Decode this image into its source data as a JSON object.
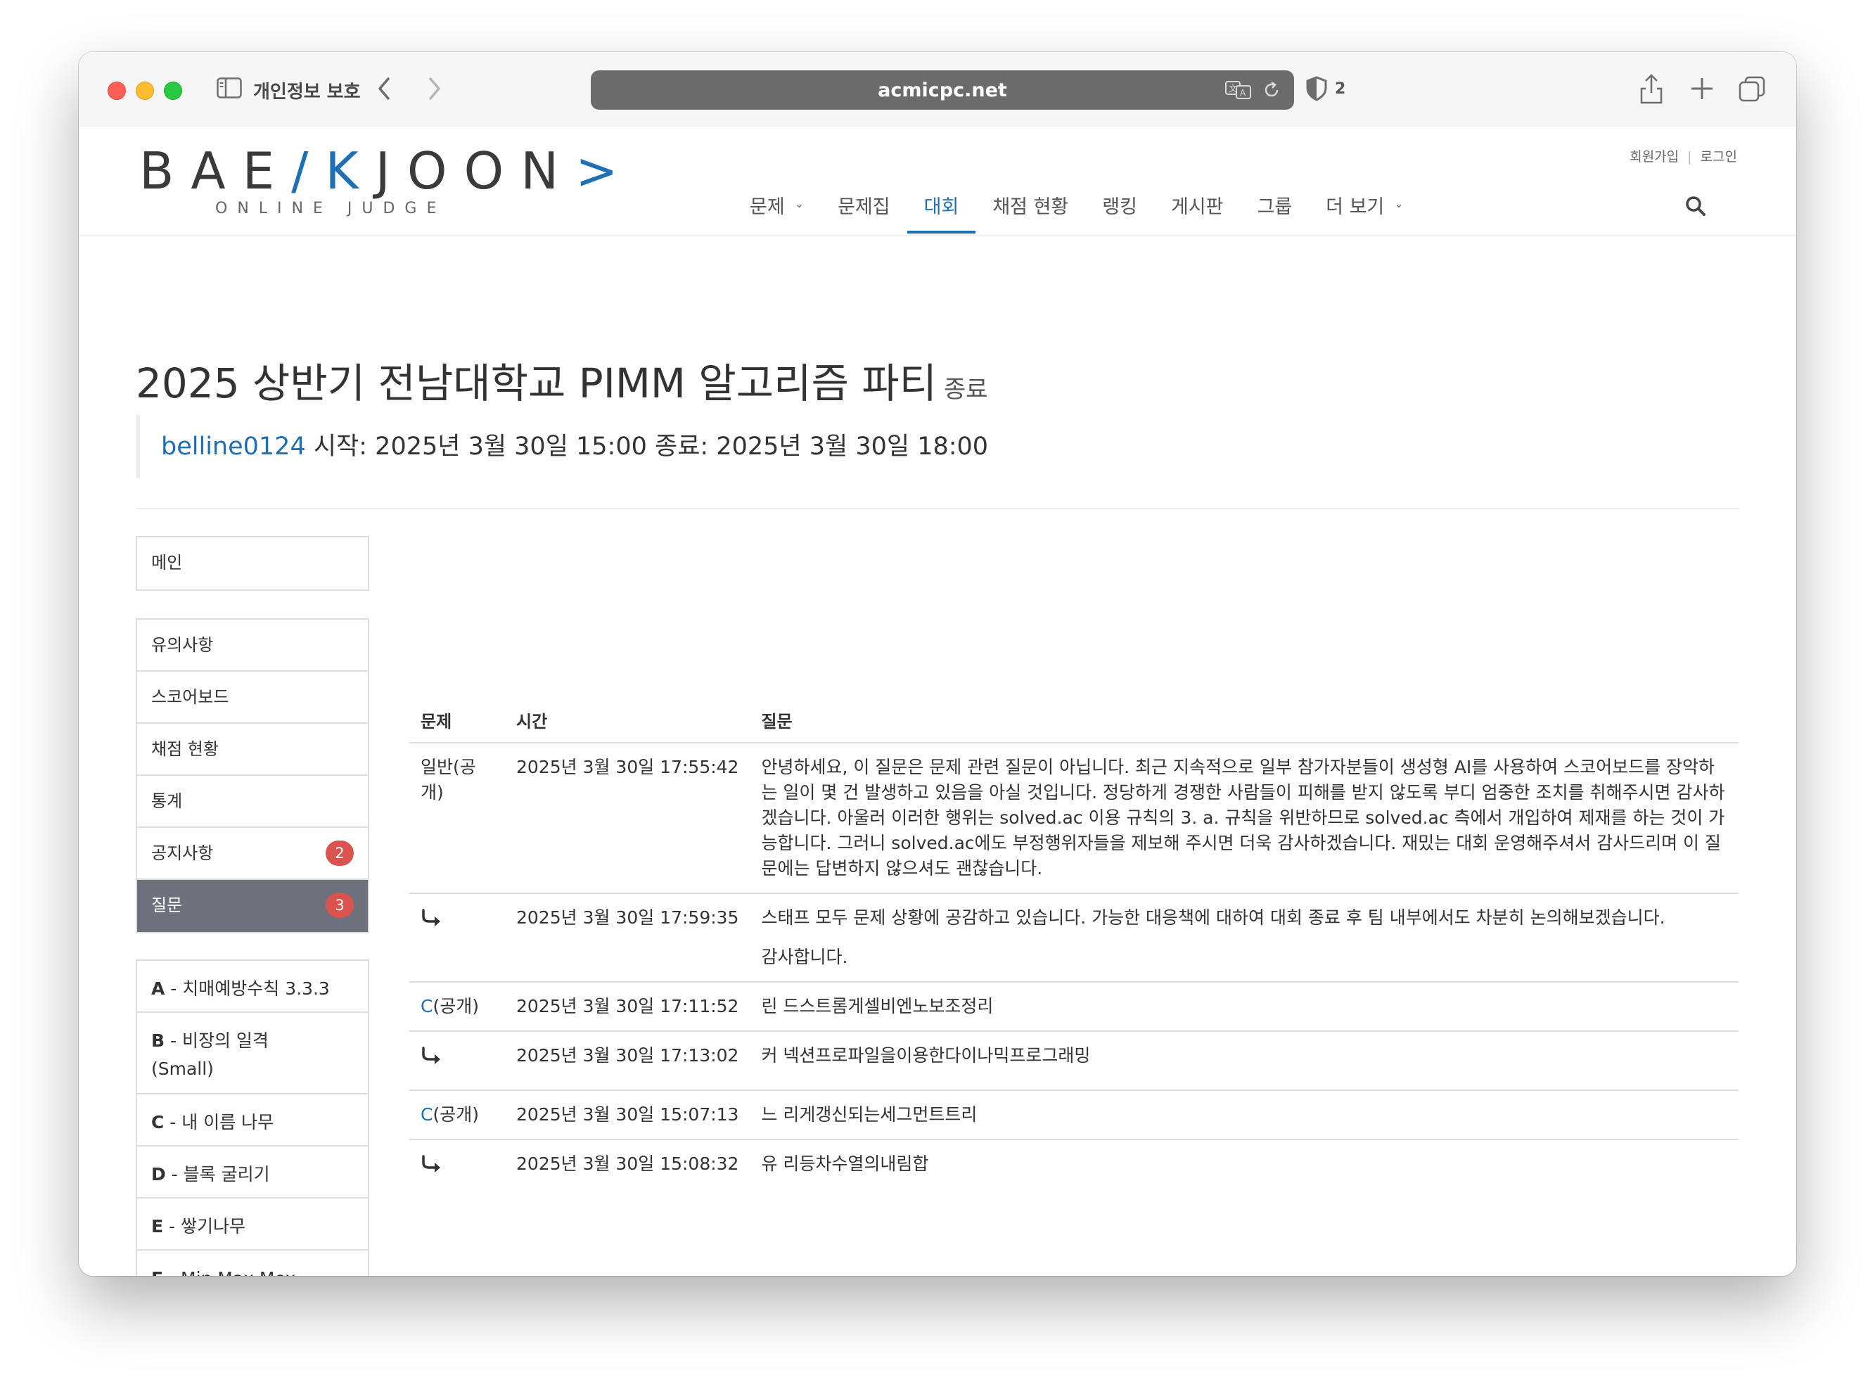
{
  "browser": {
    "tab_group_label": "개인정보 보호",
    "url": "acmicpc.net",
    "shield_count": "2"
  },
  "site": {
    "logo_main_1": "BAE",
    "logo_main_accent": "/K",
    "logo_main_2": "JOON",
    "logo_main_accent2": ">",
    "logo_sub": "ONLINE JUDGE",
    "top_links": [
      "회원가입",
      "로그인"
    ],
    "nav": [
      {
        "label": "문제",
        "dropdown": true
      },
      {
        "label": "문제집"
      },
      {
        "label": "대회",
        "active": true
      },
      {
        "label": "채점 현황"
      },
      {
        "label": "랭킹"
      },
      {
        "label": "게시판"
      },
      {
        "label": "그룹"
      },
      {
        "label": "더 보기",
        "dropdown": true
      }
    ]
  },
  "contest": {
    "title": "2025 상반기 전남대학교 PIMM 알고리즘 파티",
    "status": "종료",
    "user": "belline0124",
    "start_label": " 시작: ",
    "start": "2025년 3월 30일 15:00",
    "end_label": " 종료: ",
    "end": "2025년 3월 30일 18:00"
  },
  "menu": {
    "main": "메인",
    "items": [
      {
        "label": "유의사항"
      },
      {
        "label": "스코어보드"
      },
      {
        "label": "채점 현황"
      },
      {
        "label": "통계"
      },
      {
        "label": "공지사항",
        "badge": "2"
      },
      {
        "label": "질문",
        "badge": "3",
        "active": true
      }
    ],
    "problems": [
      {
        "id": "A",
        "title": " - 치매예방수칙 3.3.3"
      },
      {
        "id": "B",
        "title": " - 비장의 일격 (Small)"
      },
      {
        "id": "C",
        "title": " - 내 이름 나무"
      },
      {
        "id": "D",
        "title": " - 블록 굴리기"
      },
      {
        "id": "E",
        "title": " - 쌓기나무"
      },
      {
        "id": "F",
        "title": " - Min Max Mex"
      }
    ]
  },
  "questions": {
    "headers": {
      "problem": "문제",
      "time": "시간",
      "question": "질문"
    },
    "rows": [
      {
        "problem": "일반(공개)",
        "time": "2025년 3월 30일 17:55:42",
        "text": "안녕하세요, 이 질문은 문제 관련 질문이 아닙니다. 최근 지속적으로 일부 참가자분들이 생성형 AI를 사용하여 스코어보드를 장악하는 일이 몇 건 발생하고 있음을 아실 것입니다. 정당하게 경쟁한 사람들이 피해를 받지 않도록 부디 엄중한 조치를 취해주시면 감사하겠습니다. 아울러 이러한 행위는 solved.ac 이용 규칙의 3. a. 규칙을 위반하므로 solved.ac 측에서 개입하여 제재를 하는 것이 가능합니다. 그러니 solved.ac에도 부정행위자들을 제보해 주시면 더욱 감사하겠습니다. 재밌는 대회 운영해주셔서 감사드리며 이 질문에는 답변하지 않으셔도 괜찮습니다.",
        "reply_time": "2025년 3월 30일 17:59:35",
        "reply": "스태프 모두 문제 상황에 공감하고 있습니다. 가능한 대응책에 대하여 대회 종료 후 팀 내부에서도 차분히 논의해보겠습니다.",
        "reply_extra": "감사합니다."
      },
      {
        "problem_link": "C",
        "problem_suffix": "(공개)",
        "time": "2025년 3월 30일 17:11:52",
        "text": "린 드스트롬게셀비엔노보조정리",
        "reply_time": "2025년 3월 30일 17:13:02",
        "reply": "커 넥션프로파일을이용한다이나믹프로그래밍"
      },
      {
        "problem_link": "C",
        "problem_suffix": "(공개)",
        "time": "2025년 3월 30일 15:07:13",
        "text": "느 리게갱신되는세그먼트트리",
        "reply_time": "2025년 3월 30일 15:08:32",
        "reply": "유 리등차수열의내림합"
      }
    ]
  }
}
